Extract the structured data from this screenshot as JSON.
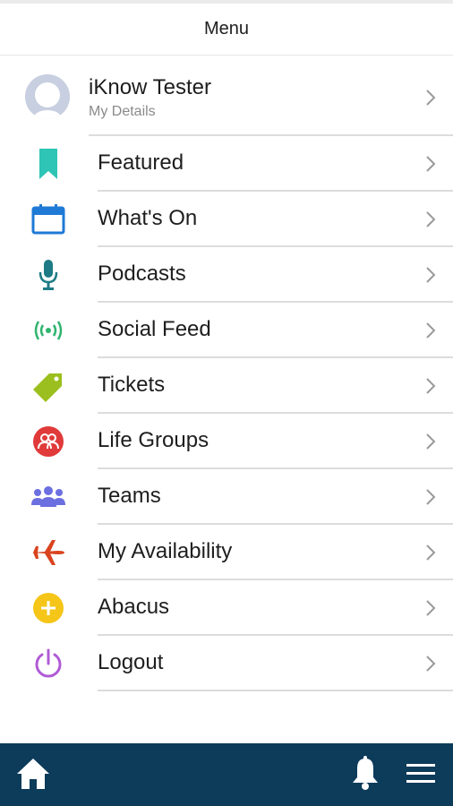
{
  "header": {
    "title": "Menu"
  },
  "profile": {
    "name": "iKnow Tester",
    "subtitle": "My Details"
  },
  "menu": {
    "items": [
      {
        "label": "Featured",
        "icon": "bookmark-icon",
        "color": "#2ec4b6"
      },
      {
        "label": "What's On",
        "icon": "calendar-icon",
        "color": "#1f7ad6"
      },
      {
        "label": "Podcasts",
        "icon": "microphone-icon",
        "color": "#1e7b85"
      },
      {
        "label": "Social Feed",
        "icon": "broadcast-icon",
        "color": "#2fb46e"
      },
      {
        "label": "Tickets",
        "icon": "tag-icon",
        "color": "#9bbf1e"
      },
      {
        "label": "Life Groups",
        "icon": "group-circle-icon",
        "color": "#e03a3a"
      },
      {
        "label": "Teams",
        "icon": "people-icon",
        "color": "#6b6fe0"
      },
      {
        "label": "My Availability",
        "icon": "airplane-icon",
        "color": "#d9441f"
      },
      {
        "label": "Abacus",
        "icon": "plus-circle-icon",
        "color": "#f5c518"
      },
      {
        "label": "Logout",
        "icon": "power-icon",
        "color": "#b05bd6"
      }
    ]
  },
  "bottom_nav": {
    "home": "home-icon",
    "notifications": "bell-icon",
    "menu": "hamburger-icon",
    "bar_color": "#0d3b5a"
  }
}
